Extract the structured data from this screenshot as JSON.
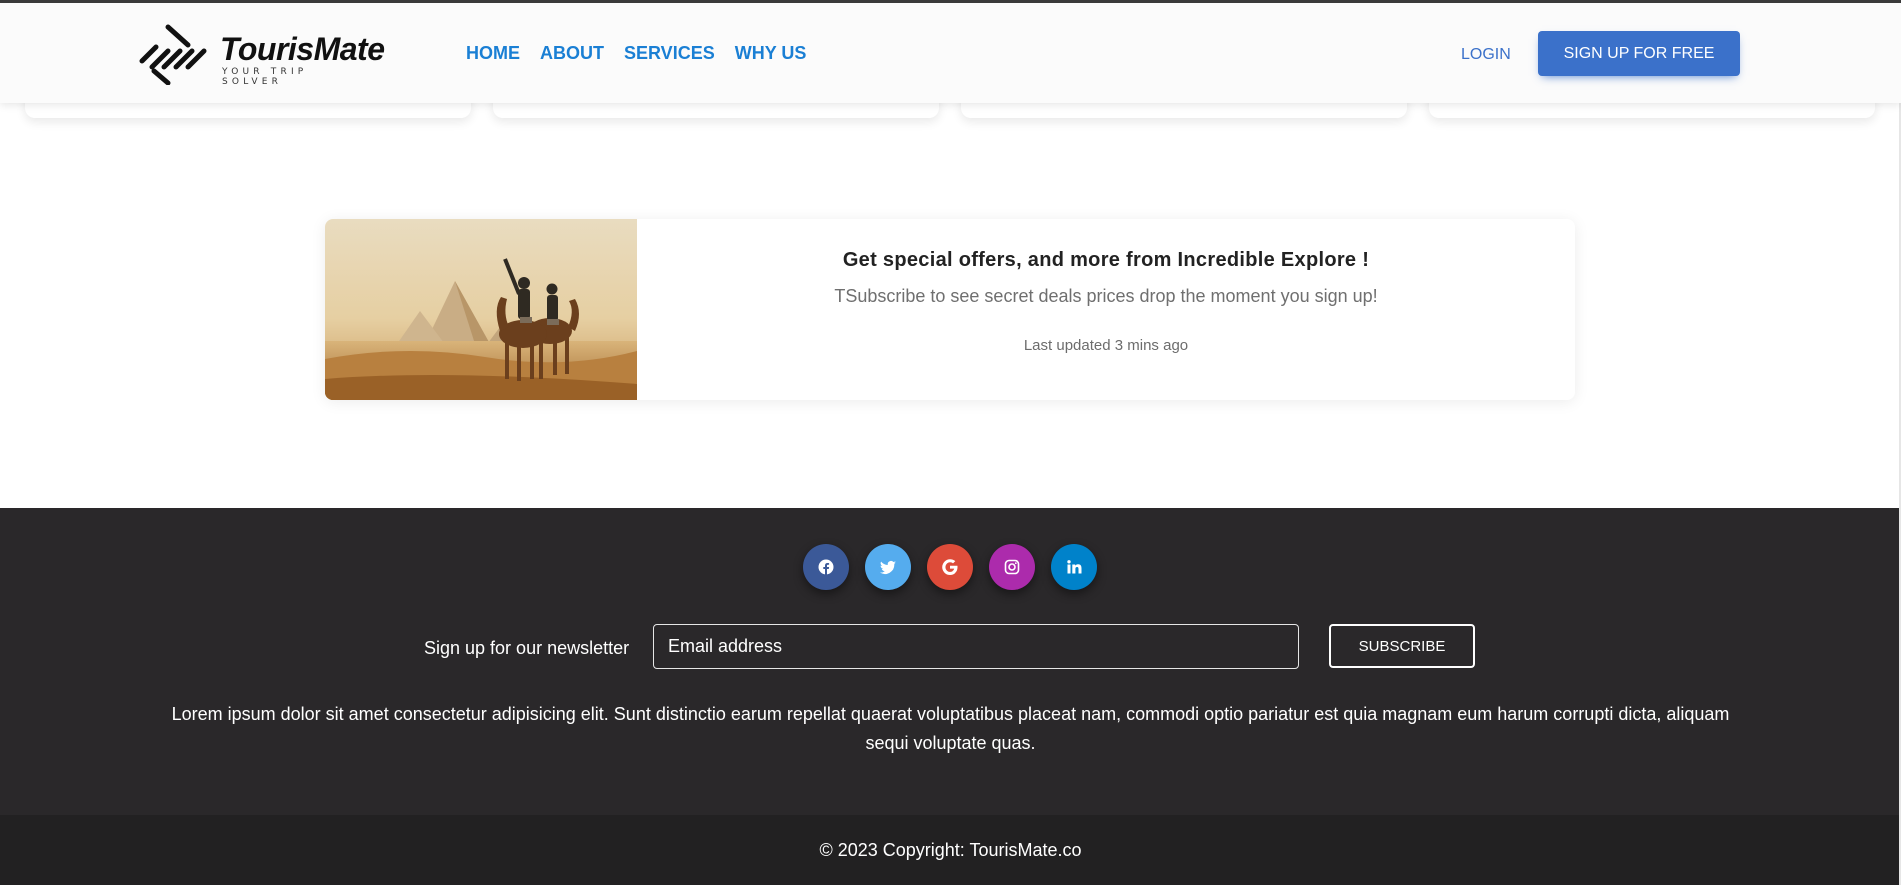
{
  "brand": {
    "name": "TourisMate",
    "tagline": "YOUR TRIP SOLVER"
  },
  "nav": {
    "links": [
      "HOME",
      "ABOUT",
      "SERVICES",
      "WHY US"
    ],
    "login": "LOGIN",
    "signup": "SIGN UP FOR FREE"
  },
  "offer": {
    "image": "camels-pyramids-photo",
    "title": "Get special offers, and more from Incredible Explore !",
    "text": "TSubscribe to see secret deals prices drop the moment you sign up!",
    "meta": "Last updated 3 mins ago"
  },
  "footer": {
    "socials": [
      {
        "icon": "facebook-icon",
        "color": "#3b5998"
      },
      {
        "icon": "twitter-icon",
        "color": "#55acee"
      },
      {
        "icon": "google-icon",
        "color": "#dd4b39"
      },
      {
        "icon": "instagram-icon",
        "color": "#ac2bac"
      },
      {
        "icon": "linkedin-icon",
        "color": "#0082ca"
      }
    ],
    "newsletter_label": "Sign up for our newsletter",
    "email_placeholder": "Email address",
    "subscribe": "SUBSCRIBE",
    "lorem": "Lorem ipsum dolor sit amet consectetur adipisicing elit. Sunt distinctio earum repellat quaerat voluptatibus placeat nam, commodi optio pariatur est quia magnam eum harum corrupti dicta, aliquam sequi voluptate quas.",
    "copyright": "© 2023 Copyright: TourisMate.co"
  },
  "colors": {
    "primary": "#3b71ca",
    "nav_link": "#1a7fd4",
    "footer_bg": "#2a282a",
    "copyright_bg": "#222122"
  }
}
